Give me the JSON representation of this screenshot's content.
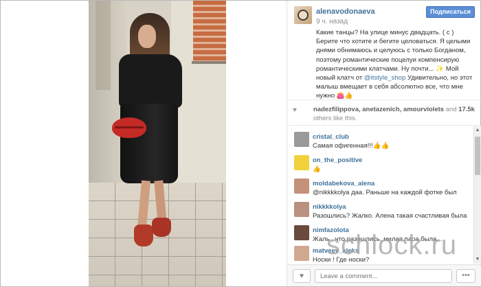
{
  "post": {
    "username": "alenavodonaeva",
    "time": "9 ч. назад",
    "follow_label": "Подписаться",
    "caption_main": "Какие танцы? На улице минус двадцать. ( с ) Берите что хотите и бегите целоваться. Я целыми днями обнимаюсь и целуюсь с только Богданом, поэтому романтические поцелуи компенсирую романтическими клатчами. Ну почти... ✨ Мой новый клатч от ",
    "caption_mention": "@itstyle_shop",
    "caption_tail": " Удивительно, но этот малыш вмещает в себя абсолютно все, что мне нужно 👛👍"
  },
  "likes": {
    "users": "nadezfilippova, anetazenich, amourviolets",
    "connector": " and ",
    "count": "17.5k",
    "suffix": "others like this."
  },
  "comments": [
    {
      "user": "cristal_club",
      "text": "Самая офигенная!!!👍👍",
      "avatar_color": "#9a9a9a"
    },
    {
      "user": "on_the_positive",
      "text": "👍",
      "avatar_color": "#f2d23a"
    },
    {
      "user": "moldabekova_alena",
      "text": "@nikkkkolya даа. Раньше на каждой фотке был",
      "avatar_color": "#c4917a"
    },
    {
      "user": "nikkkkolya",
      "text": "Разошлись? Жалко. Алена такая счастливая была",
      "avatar_color": "#b8927f"
    },
    {
      "user": "nimfazolota",
      "text": "Жаль , что разошлись, милая пара была...",
      "avatar_color": "#6a4a3c"
    },
    {
      "user": "matveev_aleks",
      "text": "Носки ! Где носки?",
      "avatar_color": "#d0a890"
    }
  ],
  "footer": {
    "comment_placeholder": "Leave a comment...",
    "more_label": "•••"
  },
  "watermark": "schlock.ru",
  "icons": {
    "heart": "heart-icon",
    "more": "more-options-icon"
  }
}
